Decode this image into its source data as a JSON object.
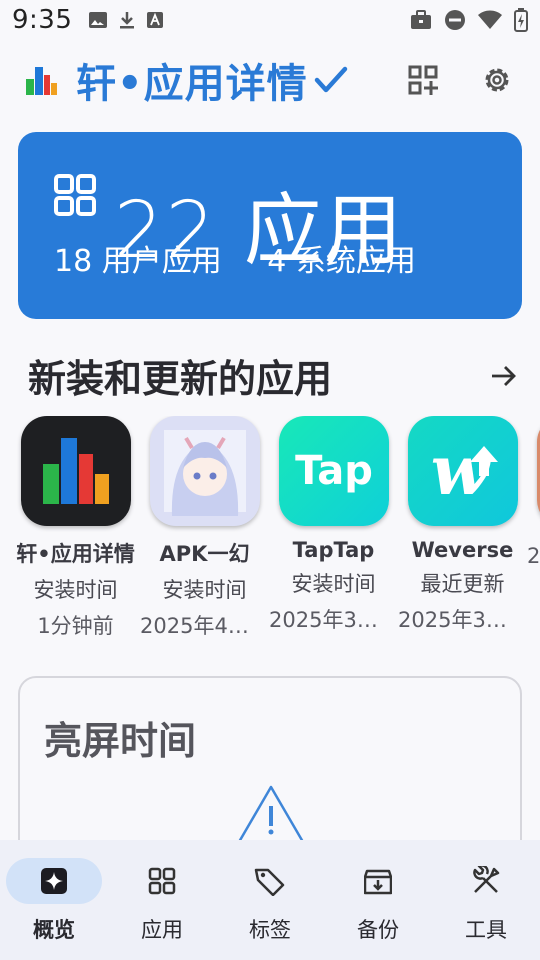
{
  "status_bar": {
    "time": "9:35",
    "left_icons": [
      "image-icon",
      "download-icon",
      "text-icon"
    ],
    "right_icons": [
      "briefcase-icon",
      "dnd-icon",
      "wifi-icon",
      "battery-icon"
    ]
  },
  "app_bar": {
    "title": "轩•应用详情",
    "actions": [
      "add-widget-icon",
      "settings-icon"
    ]
  },
  "summary": {
    "title": "22 应用",
    "user_apps": "18 用户应用",
    "system_apps": "4 系统应用",
    "card_color": "#287bd8"
  },
  "recent": {
    "title": "新装和更新的应用",
    "apps": [
      {
        "name": "轩•应用详情",
        "event": "安装时间",
        "time": "1分钟前"
      },
      {
        "name": "APK一幻",
        "event": "安装时间",
        "time": "2025年4月…"
      },
      {
        "name": "TapTap",
        "event": "安装时间",
        "time": "2025年3月…",
        "icon_text": "Tap"
      },
      {
        "name": "Weverse",
        "event": "最近更新",
        "time": "2025年3月…",
        "icon_text": "w"
      },
      {
        "name": "",
        "event": "",
        "time": "2"
      }
    ]
  },
  "screen_time": {
    "title": "亮屏时间"
  },
  "nav": {
    "items": [
      {
        "label": "概览",
        "icon": "overview-icon",
        "active": true
      },
      {
        "label": "应用",
        "icon": "apps-grid-icon",
        "active": false
      },
      {
        "label": "标签",
        "icon": "tag-icon",
        "active": false
      },
      {
        "label": "备份",
        "icon": "backup-icon",
        "active": false
      },
      {
        "label": "工具",
        "icon": "tools-icon",
        "active": false
      }
    ]
  },
  "colors": {
    "accent": "#2a7ad6",
    "nav_active_pill": "#d2e2f8",
    "background": "#f8f8fb"
  }
}
